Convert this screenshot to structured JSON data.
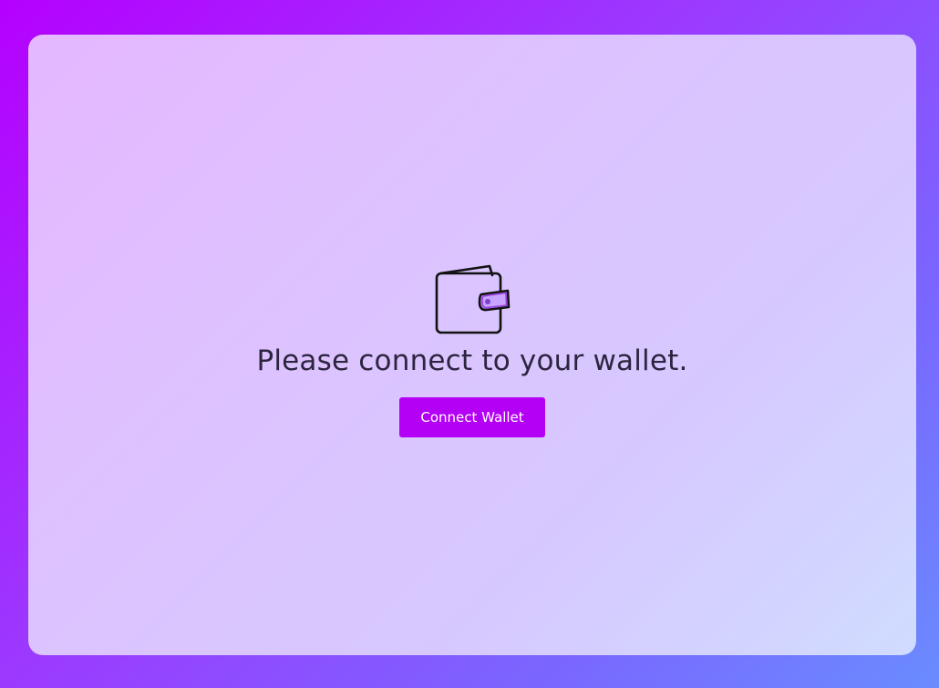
{
  "page": {
    "message": "Please connect to your wallet.",
    "connect_button_label": "Connect Wallet",
    "icon": "wallet-icon"
  },
  "colors": {
    "button_background": "#b400f5",
    "button_text": "#ffffff",
    "text": "#2d2540",
    "wallet_clasp": "#9b3fe0"
  }
}
